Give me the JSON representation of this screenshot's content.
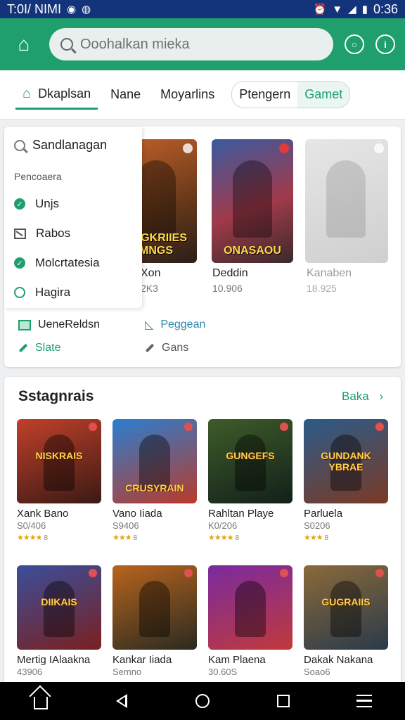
{
  "status_bar": {
    "left_text": "T:0I/ NIMI",
    "time": "0:36"
  },
  "header": {
    "search_placeholder": "Ooohalkan mieka"
  },
  "tabs": [
    {
      "label": "Dkaplsan",
      "active": true
    },
    {
      "label": "Nane"
    },
    {
      "label": "Moyarlins"
    }
  ],
  "pill_tabs": [
    "Ptengern",
    "Gamet"
  ],
  "menu": {
    "search_label": "Sandlanagan",
    "section_title": "Pencoaera",
    "items": [
      "Unjs",
      "Rabos",
      "Molcrtatesia",
      "Hagira"
    ]
  },
  "menu_bottom": {
    "left": [
      "UeneReldsn",
      "Slate"
    ],
    "right": [
      "Peggean",
      "Gans"
    ]
  },
  "featured": [
    {
      "caption": "SUGKRIIES MNGS",
      "title": "Xon",
      "count": "2K3"
    },
    {
      "caption": "ONASAOU",
      "title": "Deddin",
      "count": "10.906"
    },
    {
      "caption": "",
      "title": "Kanaben",
      "count": "18.925"
    }
  ],
  "section": {
    "title": "Sstagnrais",
    "see_all": "Baka"
  },
  "games": [
    {
      "label": "NISKRAIS",
      "name": "Xank Bano",
      "price": "S0/406",
      "stars": "★★★★",
      "count": "8",
      "colors": [
        "#c1402a",
        "#3a1a14"
      ]
    },
    {
      "label": "CRUSYRAIN",
      "name": "Vano Iiada",
      "price": "S9406",
      "stars": "★★★",
      "count": "8",
      "colors": [
        "#2a7fd0",
        "#b93a2a"
      ]
    },
    {
      "label": "GUNGEFS",
      "name": "Rahltan Playe",
      "price": "K0/206",
      "stars": "★★★★",
      "count": "8",
      "colors": [
        "#3e5c2a",
        "#12201a"
      ]
    },
    {
      "label": "GUNDANK YBRAE",
      "name": "Parluela",
      "price": "S0206",
      "stars": "★★★",
      "count": "8",
      "colors": [
        "#2b5b8a",
        "#7a3a24"
      ]
    },
    {
      "label": "DIIKAIS",
      "name": "Mertig IAlaakna",
      "price": "43906",
      "stars": "",
      "count": "",
      "colors": [
        "#3a4e9a",
        "#7a2020"
      ]
    },
    {
      "label": "",
      "name": "Kankar Iiada",
      "price": "Semno",
      "stars": "",
      "count": "",
      "colors": [
        "#b8641e",
        "#2a2a20"
      ]
    },
    {
      "label": "",
      "name": "Kam Plaena",
      "price": "30.60S",
      "stars": "",
      "count": "",
      "colors": [
        "#7a2aa0",
        "#c03a3a"
      ]
    },
    {
      "label": "GUGRAIIS",
      "name": "Dakak Nakana",
      "price": "Soao6",
      "stars": "",
      "count": "",
      "colors": [
        "#8a6a3a",
        "#2a3a4a"
      ]
    }
  ]
}
